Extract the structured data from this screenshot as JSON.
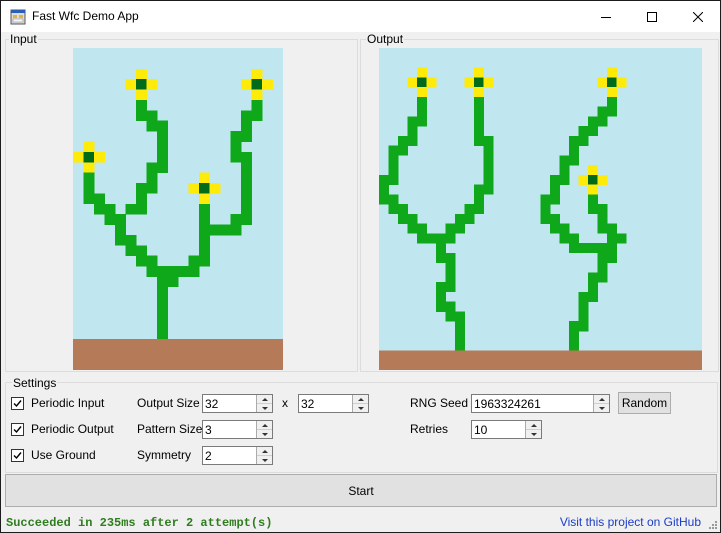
{
  "window": {
    "title": "Fast Wfc Demo App"
  },
  "colors": {
    "sky": "#c0e6ef",
    "ground": "#b57a57",
    "stem": "#0ea81a",
    "petal": "#ffeb0a",
    "center": "#006b1b",
    "status": "#2e7d1e",
    "link": "#1a3cc8"
  },
  "input": {
    "label": "Input",
    "rows": [
      "AAAAAAAAAAAAAAAAAAAA",
      "AAAAAAAAAAAAAAAAAAAA",
      "AAAAAAYAAAAAAAAAAYAA",
      "AAAAAYCYAAAAAAAAYCYA",
      "AAAAAAYAAAAAAAAAAYAA",
      "AAAAAAGAAAAAAAAAAGAA",
      "AAAAAAGGAAAAAAAAGGAA",
      "AAAAAAAGGAAAAAAAGAAA",
      "AAAAAAAAGAAAAAAGGAAA",
      "AYAAAAAAGAAAAAAGAAAA",
      "YCYAAAAAGAAAAAAGGAAA",
      "AYAAAAAGGAAAAAAAGAAA",
      "AGAAAAAGAAAAYAAAGAAA",
      "AGAAAAGGAAAYCYAAGAAA",
      "AGGAAAGAAAAAYAAAGAAA",
      "AAGGAGGAAAAAGAAAGAAA",
      "AAAGGAAAAAAAGAAGGAAA",
      "AAAAGAAAAAAAGGGGAAAA",
      "AAAAGGAAAAAAGAAAAAAA",
      "AAAAAGGAAAAAGAAAAAAA",
      "AAAAAAGGAAAGGAAAAAAA",
      "AAAAAAAGGGGGAAAAAAAA",
      "AAAAAAAAGGAAAAAAAAAA",
      "AAAAAAAAGAAAAAAAAAAA",
      "AAAAAAAAGAAAAAAAAAAA",
      "AAAAAAAAGAAAAAAAAAAA",
      "AAAAAAAAGAAAAAAAAAAA",
      "AAAAAAAAGAAAAAAAAAAA",
      "BBBBBBBBBBBBBBBBBBBB",
      "BBBBBBBBBBBBBBBBBBBB",
      "BBBBBBBBBBBBBBBBBBBB"
    ]
  },
  "output": {
    "label": "Output",
    "rows": [
      "AAAAAAAAAAAAAAAAAAAAAAAAAAAAAAAAAA",
      "AAAAAAAAAAAAAAAAAAAAAAAAAAAAAAAAAA",
      "AAAAYAAAAAYAAAAAAAAAAAAAYAAAAAAAAA",
      "AAAYCYAAAYCYAAAAAAAAAAAYCYAAAAAAAA",
      "AAAAYAAAAAYAAAAAAAAAAAAAYAAAAAAAAA",
      "AAAAGAAAAAGAAAAAAAAAAAAAGAAAAAAAAA",
      "AAAAGAAAAAGAAAAAAAAAAAAGGAAAAAAAAA",
      "AAAGGAAAAAGAAAAAAAAAAAGGAAAAAAAAAA",
      "AAAGAAAAAAGAAAAAAAAAAGGAAAAAAAAAAA",
      "AAGGAAAAAAGGAAAAAAAAGGAAAAAAAAAAAA",
      "AGGAAAAAAAAGAAAAAAAAGAAAAAAAAAAAAA",
      "AGAAAAAAAAAGAAAAAAAGGAAAAAAAAAAAAA",
      "AGAAAAAAAAAGAAAAAAAGAAYAAAAAAAAAAA",
      "GGAAAAAAAAAGAAAAAAGGAYCYAAAAAAAAAA",
      "GAAAAAAAAAGGAAAAAAGAAAYAAAAAAAAAAA",
      "GGAAAAAAAAGAAAAAAGGAAAGAAAAAAAAAAA",
      "AGGAAAAAAGGAAAAAAGAAAAGGAAAAAAAAAA",
      "AAGGAAAAGGAAAAAAAGGAAAAGAAAAAAAAAA",
      "AAAGGAAGGAAAAAAAAAGGAAAGGAAAAAAAAA",
      "AAAAGGGGAAAAAAAAAAAGGAAAGGAAAAAAAA",
      "AAAAAAGAAAAAAAAAAAAAGGGGGAAAAAAAAA",
      "AAAAAAGGAAAAAAAAAAAAAAAGGAAAAAAAAA",
      "AAAAAAAGAAAAAAAAAAAAAAAGAAAAAAAAAA",
      "AAAAAAAGAAAAAAAAAAAAAAGGAAAAAAAAAA",
      "AAAAAAGGAAAAAAAAAAAAAAGAAAAAAAAAAA",
      "AAAAAAGAAAAAAAAAAAAAAGGAAAAAAAAAAA",
      "AAAAAAGGAAAAAAAAAAAAAGAAAAAAAAAAAA",
      "AAAAAAAGGAAAAAAAAAAAAGAAAAAAAAAAAA",
      "AAAAAAAAGAAAAAAAAAAAGGAAAAAAAAAAAA",
      "AAAAAAAAGAAAAAAAAAAAGAAAAAAAAAAAAA",
      "AAAAAAAAGAAAAAAAAAAAGAAAAAAAAAAAAA",
      "BBBBBBBBBBBBBBBBBBBBBBBBBBBBBBBBBB",
      "BBBBBBBBBBBBBBBBBBBBBBBBBBBBBBBBBB"
    ]
  },
  "settings": {
    "label": "Settings",
    "periodic_input": {
      "label": "Periodic Input",
      "checked": true
    },
    "periodic_output": {
      "label": "Periodic Output",
      "checked": true
    },
    "use_ground": {
      "label": "Use Ground",
      "checked": true
    },
    "output_size_label": "Output Size",
    "output_width": "32",
    "times": "x",
    "output_height": "32",
    "pattern_size_label": "Pattern Size",
    "pattern_size": "3",
    "symmetry_label": "Symmetry",
    "symmetry": "2",
    "rng_seed_label": "RNG Seed",
    "rng_seed": "1963324261",
    "random_button": "Random",
    "retries_label": "Retries",
    "retries": "10"
  },
  "start_button": "Start",
  "status": {
    "message": "Succeeded in 235ms after 2 attempt(s)",
    "link": "Visit this project on GitHub"
  }
}
